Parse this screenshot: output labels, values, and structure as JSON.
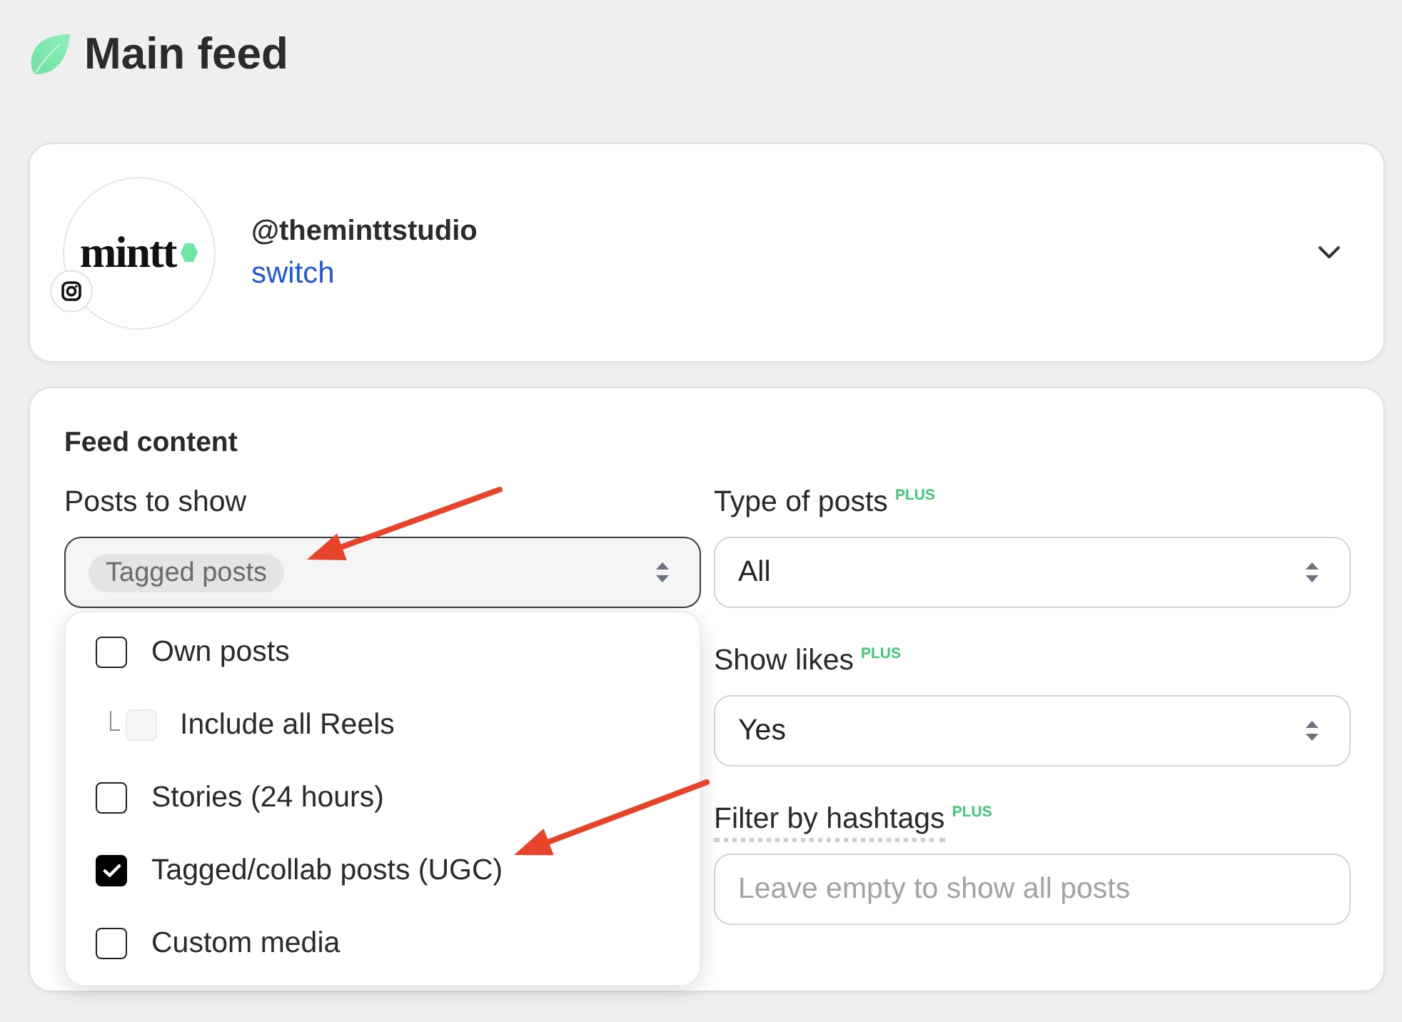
{
  "header": {
    "title": "Main feed"
  },
  "account": {
    "logo_text": "mintt",
    "handle": "@theminttstudio",
    "switch_link": "switch",
    "expanded": false
  },
  "feed_content": {
    "title": "Feed content",
    "posts_to_show": {
      "label": "Posts to show",
      "selected_tags": [
        "Tagged posts"
      ],
      "expanded": true,
      "options": [
        {
          "label": "Own posts",
          "checked": false,
          "disabled": false,
          "children": [
            {
              "label": "Include all Reels",
              "checked": false,
              "disabled": true
            }
          ]
        },
        {
          "label": "Stories (24 hours)",
          "checked": false,
          "disabled": false
        },
        {
          "label": "Tagged/collab posts (UGC)",
          "checked": true,
          "disabled": false
        },
        {
          "label": "Custom media",
          "checked": false,
          "disabled": false
        }
      ]
    },
    "fields": [
      {
        "kind": "select",
        "label": "Type of posts",
        "badge": "PLUS",
        "tooltip": false,
        "value": "All"
      },
      {
        "kind": "select",
        "label": "Show likes",
        "badge": "PLUS",
        "tooltip": false,
        "value": "Yes"
      },
      {
        "kind": "text",
        "label": "Filter by hashtags",
        "badge": "PLUS",
        "tooltip": true,
        "placeholder": "Leave empty to show all posts"
      }
    ]
  },
  "annotations": [
    {
      "kind": "arrow"
    },
    {
      "kind": "arrow"
    }
  ]
}
